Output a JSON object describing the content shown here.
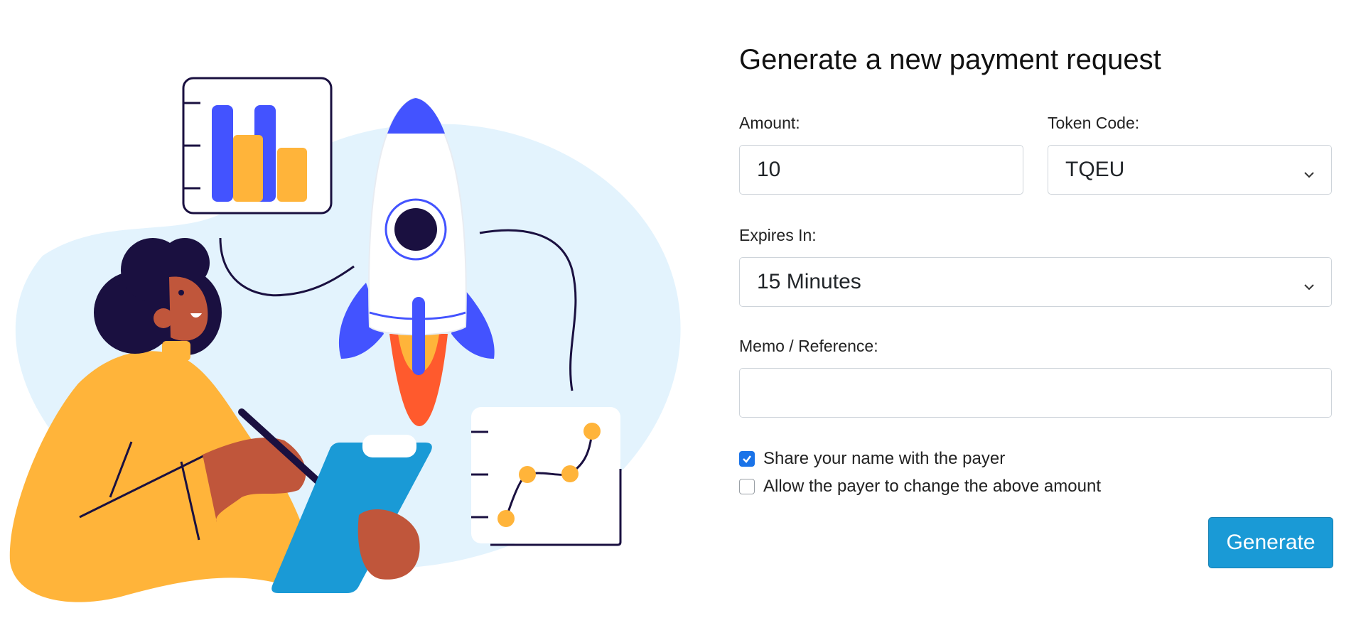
{
  "form": {
    "title": "Generate a new payment request",
    "amount": {
      "label": "Amount:",
      "value": "10"
    },
    "token_code": {
      "label": "Token Code:",
      "selected": "TQEU"
    },
    "expires_in": {
      "label": "Expires In:",
      "selected": "15 Minutes"
    },
    "memo": {
      "label": "Memo / Reference:",
      "value": ""
    },
    "share_name": {
      "label": "Share your name with the payer",
      "checked": true
    },
    "allow_change": {
      "label": "Allow the payer to change the above amount",
      "checked": false
    },
    "generate_label": "Generate"
  },
  "colors": {
    "accent": "#1a9ad6",
    "checkbox_checked": "#1a73e8",
    "illustration_blue": "#4353ff",
    "illustration_yellow": "#ffb43a",
    "illustration_background": "#e3f3fd"
  },
  "icons": [
    "chevron-down-icon",
    "checkmark-icon"
  ]
}
